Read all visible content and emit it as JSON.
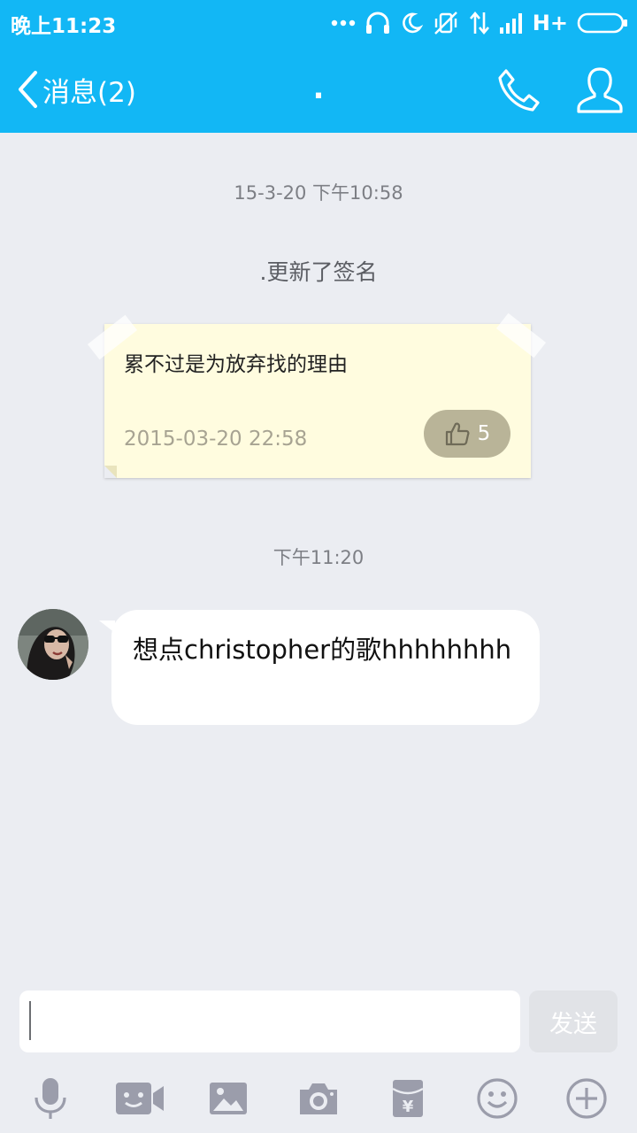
{
  "status_bar": {
    "time": "晚上11:23",
    "network": "H+",
    "icons": [
      "more-dots-icon",
      "headphones-icon",
      "moon-icon",
      "vibrate-silent-icon",
      "data-arrows-icon",
      "signal-bars-icon",
      "battery-icon"
    ]
  },
  "nav": {
    "back_label": "消息(2)",
    "title": ".",
    "icons": [
      "chevron-left-icon",
      "phone-icon",
      "person-icon"
    ]
  },
  "chat": {
    "timestamp_1": "15-3-20 下午10:58",
    "system_message": ".更新了签名",
    "signature_card": {
      "text": "累不过是为放弃找的理由",
      "date": "2015-03-20 22:58",
      "like_count": "5"
    },
    "timestamp_2": "下午11:20",
    "message": {
      "text": "想点christopher的歌hhhhhhhh"
    }
  },
  "composer": {
    "input_value": "",
    "send_label": "发送"
  },
  "toolbar": {
    "items": [
      "microphone-icon",
      "video-call-icon",
      "image-icon",
      "camera-icon",
      "red-packet-icon",
      "emoji-icon",
      "plus-icon"
    ]
  },
  "colors": {
    "brand": "#12b7f5",
    "background": "#ebedf2",
    "card": "#fffcdf",
    "like_pill": "#b9b498",
    "toolbar_icons": "#9b9dab"
  }
}
